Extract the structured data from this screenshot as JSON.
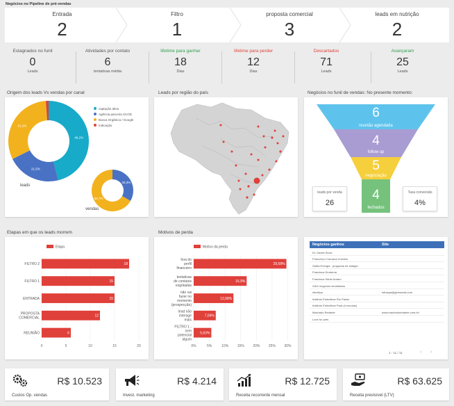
{
  "page": {
    "title": "Negócios no Pipeline de pré-vendas"
  },
  "pipeline": [
    {
      "label": "Entrada",
      "value": "2"
    },
    {
      "label": "Filtro",
      "value": "1"
    },
    {
      "label": "proposta comercial",
      "value": "3"
    },
    {
      "label": "leads em nutrição",
      "value": "2"
    }
  ],
  "stats": [
    {
      "title": "Estagnados no funil",
      "value": "0",
      "sub": "Leads",
      "color": "#555555"
    },
    {
      "title": "Atividades por contato",
      "value": "6",
      "sub": "tentativas média",
      "color": "#555555"
    },
    {
      "title": "lifetime para ganhar",
      "value": "18",
      "sub": "Dias",
      "color": "#2e9e4b"
    },
    {
      "title": "lifetime para perder",
      "value": "12",
      "sub": "Dias",
      "color": "#e0403a"
    },
    {
      "title": "Descartados",
      "value": "71",
      "sub": "Leads",
      "color": "#e0403a"
    },
    {
      "title": "Avançaram",
      "value": "25",
      "sub": "Leads",
      "color": "#2e9e4b"
    }
  ],
  "origem": {
    "title": "Origem dos leads Vs vendas por canal",
    "legend": [
      {
        "label": "captação ativa",
        "color": "#18aac9"
      },
      {
        "label": "Agência parceira XCOD",
        "color": "#4a72c4"
      },
      {
        "label": "Busca Orgânica / Google",
        "color": "#f2b21e"
      },
      {
        "label": "Indicação",
        "color": "#e0403a"
      }
    ],
    "leads_label": "leads",
    "vendas_label": "vendas"
  },
  "mapa": {
    "title": "Leads por região do país"
  },
  "funil": {
    "title": "Negócios no funil de vendas: No presente momento:",
    "stages": [
      {
        "value": "6",
        "label": "reunião agendada",
        "color": "#5ec3ec"
      },
      {
        "value": "4",
        "label": "follow up",
        "color": "#a99cd2"
      },
      {
        "value": "5",
        "label": "negociação",
        "color": "#f5cf3c"
      },
      {
        "value": "4",
        "label": "fechados",
        "color": "#76c27d"
      }
    ],
    "leads_title": "leads por venda",
    "leads_value": "26",
    "taxa_title": "Taxa conversão",
    "taxa_value": "4%"
  },
  "chart_data": [
    {
      "type": "pie",
      "title": "",
      "name": "leads",
      "slices": [
        {
          "label": "captação ativa",
          "value": 46.2,
          "color": "#18aac9"
        },
        {
          "label": "Agência parceira XCOD",
          "value": 21.5,
          "color": "#4a72c4"
        },
        {
          "label": "Busca Orgânica / Google",
          "value": 31.2,
          "color": "#f2b21e"
        },
        {
          "label": "Indicação",
          "value": 1.1,
          "color": "#e0403a"
        }
      ]
    },
    {
      "type": "pie",
      "title": "",
      "name": "vendas",
      "slices": [
        {
          "label": "Agência parceira XCOD",
          "value": 33.3,
          "color": "#4a72c4"
        },
        {
          "label": "Busca Orgânica / Google",
          "value": 66.7,
          "color": "#f2b21e"
        }
      ]
    },
    {
      "type": "bar",
      "title": "Etapas em que os leads morrem",
      "legend": "Etapa",
      "categories": [
        "FILTRO 2",
        "FILTRO 1",
        "ENTRADA",
        "PROPOSTA COMERCIAL",
        "REUNIÃO"
      ],
      "values": [
        18,
        15,
        15,
        12,
        6
      ],
      "labels": [
        "18",
        "15",
        "15",
        "12",
        "6"
      ],
      "xticks": [
        "0",
        "5",
        "10",
        "15",
        "20"
      ],
      "xlim": [
        0,
        20
      ],
      "color": "#e0403a"
    },
    {
      "type": "bar",
      "title": "Motivos de perda",
      "legend": "Motivo da perda",
      "categories": [
        "fora do perfil financeiro",
        "tentativas de contatos esgotadas",
        "não vai fazer no momento (prospecção)",
        "lead não interage mais",
        "FILTRO 1 - sem potencial algum"
      ],
      "values": [
        29.58,
        16.9,
        12.68,
        7.04,
        5.63
      ],
      "labels": [
        "29,58%",
        "16,9%",
        "12,68%",
        "7,04%",
        "5,63%"
      ],
      "xticks": [
        "0%",
        "5%",
        "10%",
        "15%",
        "20%",
        "25%",
        "30%"
      ],
      "xlim": [
        0,
        31
      ],
      "color": "#e0403a"
    }
  ],
  "negocios": {
    "columns": [
      "Negócios ganhos",
      "Site"
    ],
    "rows": [
      [
        "Dr. Daniel Serra",
        ""
      ],
      [
        "Francesco Carrasco Imóveis",
        ""
      ],
      [
        "Saltra Energia - programa de estágio",
        ""
      ],
      [
        "Francisca Drodema",
        ""
      ],
      [
        "Francisca Santo Amaro",
        ""
      ],
      [
        "G&G negócios imobiliários",
        ""
      ],
      [
        "infraSpa",
        "infraspa@globomail.com"
      ],
      [
        "Instituto Embelleze Rio Paiolo",
        ""
      ],
      [
        "Instituto Embelleze Pará (4 escolas)",
        ""
      ],
      [
        "Machado Redante",
        "www.machadoredante.com.br/"
      ],
      [
        "Love for pets",
        ""
      ]
    ],
    "pagination": "1 - 11 / 11"
  },
  "kpis": [
    {
      "label": "Custos Op. vendas",
      "value": "R$ 10.523",
      "icon": "gears-icon"
    },
    {
      "label": "Invest. marketing",
      "value": "R$ 4.214",
      "icon": "megaphone-icon"
    },
    {
      "label": "Receita recorrente mensal",
      "value": "R$ 12.725",
      "icon": "growth-chart-icon"
    },
    {
      "label": "Receita previsível (LTV)",
      "value": "R$ 63.625",
      "icon": "money-hand-icon"
    }
  ]
}
